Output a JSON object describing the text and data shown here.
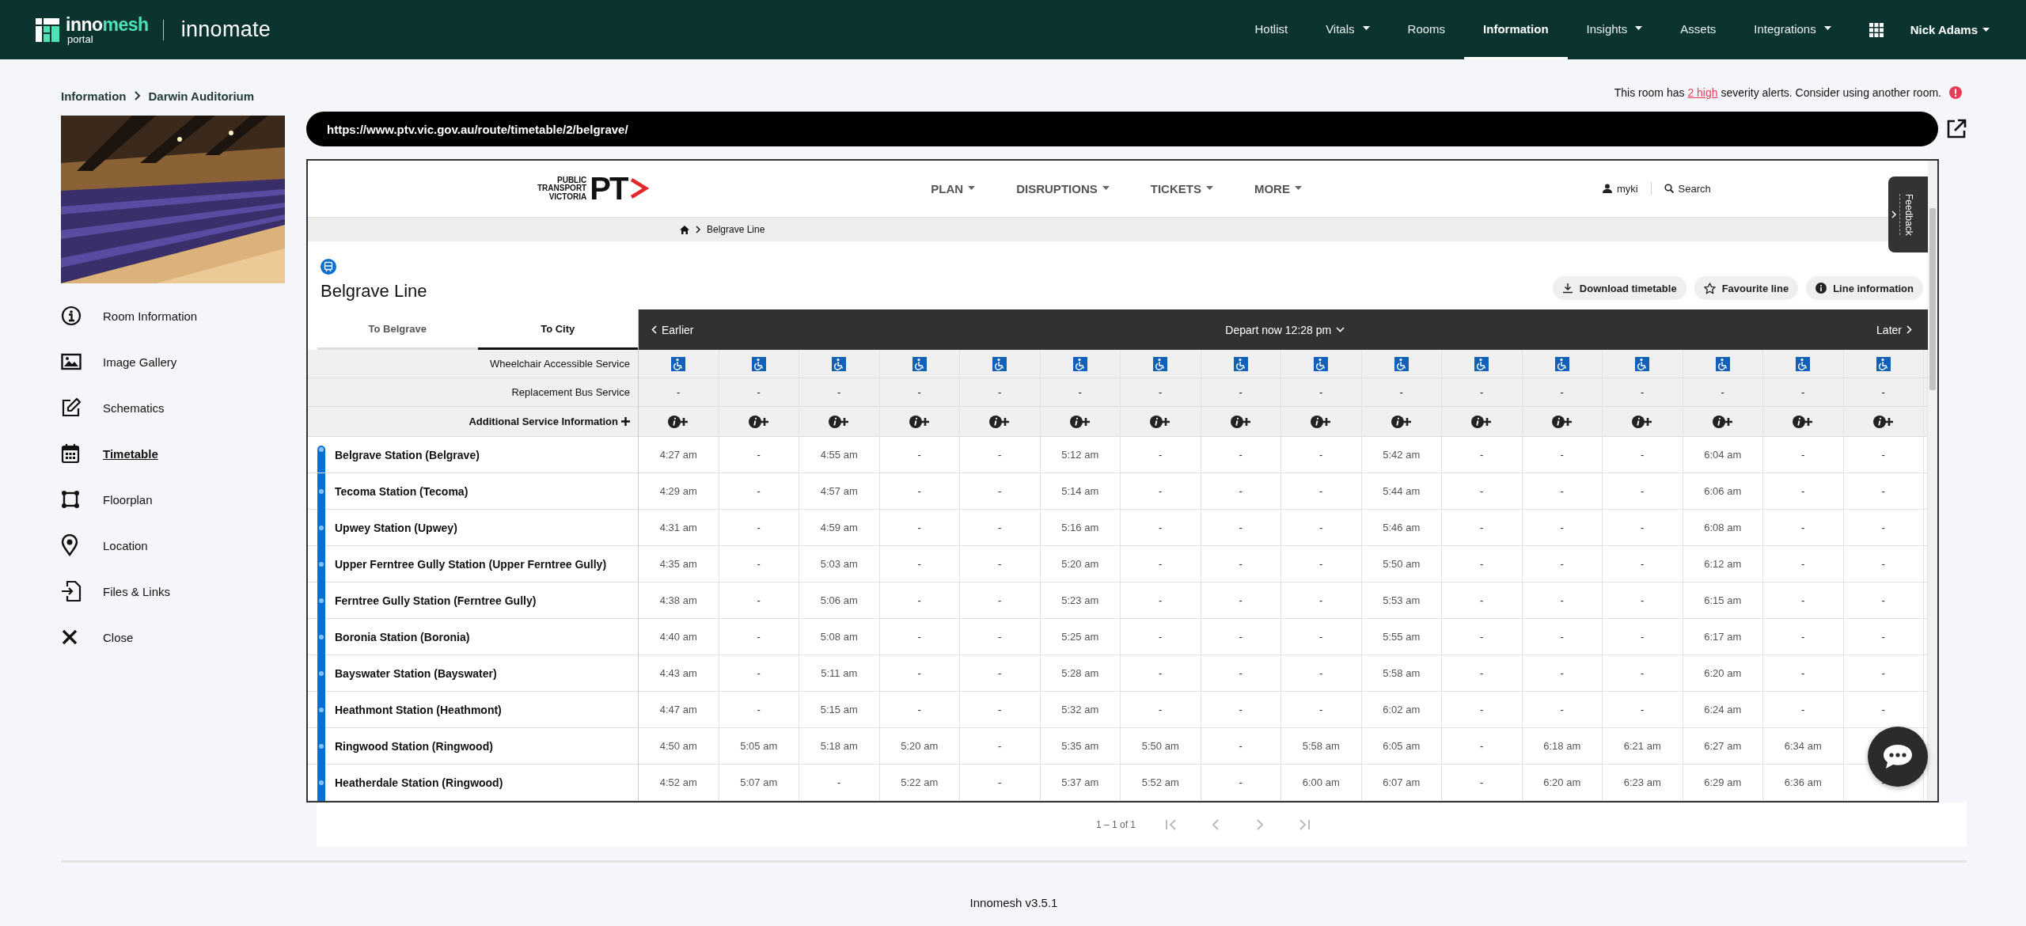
{
  "top_bar": {
    "logo_parts": [
      "inno",
      "mesh"
    ],
    "logo_subtext": "portal",
    "product": "innomate",
    "nav": [
      {
        "label": "Hotlist",
        "dropdown": false,
        "selected": false
      },
      {
        "label": "Vitals",
        "dropdown": true,
        "selected": false
      },
      {
        "label": "Rooms",
        "dropdown": false,
        "selected": false
      },
      {
        "label": "Information",
        "dropdown": false,
        "selected": true
      },
      {
        "label": "Insights",
        "dropdown": true,
        "selected": false
      },
      {
        "label": "Assets",
        "dropdown": false,
        "selected": false
      },
      {
        "label": "Integrations",
        "dropdown": true,
        "selected": false
      }
    ],
    "user": "Nick Adams"
  },
  "breadcrumb": [
    "Information",
    "Darwin Auditorium"
  ],
  "sidebar": {
    "items": [
      {
        "label": "Room Information",
        "kind": "info",
        "selected": false
      },
      {
        "label": "Image Gallery",
        "kind": "gallery",
        "selected": false
      },
      {
        "label": "Schematics",
        "kind": "edit",
        "selected": false
      },
      {
        "label": "Timetable",
        "kind": "calendar",
        "selected": true
      },
      {
        "label": "Floorplan",
        "kind": "floorplan",
        "selected": false
      },
      {
        "label": "Location",
        "kind": "location",
        "selected": false
      },
      {
        "label": "Files & Links",
        "kind": "files",
        "selected": false
      },
      {
        "label": "Close",
        "kind": "close",
        "selected": false
      }
    ]
  },
  "alert": {
    "before": "This room has",
    "link": "2 high",
    "after": "severity alerts. Consider using another room."
  },
  "url_bar": {
    "value": "https://www.ptv.vic.gov.au/route/timetable/2/belgrave/"
  },
  "ptv": {
    "logo_lines": [
      "PUBLIC",
      "TRANSPORT",
      "VICTORIA"
    ],
    "logo_mark": "PT",
    "nav": [
      "PLAN",
      "DISRUPTIONS",
      "TICKETS",
      "MORE"
    ],
    "myki": "myki",
    "search": "Search",
    "feedback": "Feedback",
    "breadcrumb": "Belgrave Line",
    "line_title": "Belgrave Line",
    "actions": [
      {
        "label": "Download timetable",
        "kind": "download"
      },
      {
        "label": "Favourite line",
        "kind": "star"
      },
      {
        "label": "Line information",
        "kind": "info"
      }
    ],
    "direction_tabs": [
      {
        "label": "To Belgrave",
        "selected": false
      },
      {
        "label": "To City",
        "selected": true
      }
    ],
    "earlier": "Earlier",
    "depart": "Depart now 12:28 pm",
    "later": "Later",
    "row_labels": {
      "wheelchair": "Wheelchair Accessible Service",
      "replacement": "Replacement Bus Service",
      "additional": "Additional Service Information"
    },
    "services": [
      {
        "wheelchair_accessible": true,
        "replacement_bus": "-"
      },
      {
        "wheelchair_accessible": true,
        "replacement_bus": "-"
      },
      {
        "wheelchair_accessible": true,
        "replacement_bus": "-"
      },
      {
        "wheelchair_accessible": true,
        "replacement_bus": "-"
      },
      {
        "wheelchair_accessible": true,
        "replacement_bus": "-"
      },
      {
        "wheelchair_accessible": true,
        "replacement_bus": "-"
      },
      {
        "wheelchair_accessible": true,
        "replacement_bus": "-"
      },
      {
        "wheelchair_accessible": true,
        "replacement_bus": "-"
      },
      {
        "wheelchair_accessible": true,
        "replacement_bus": "-"
      },
      {
        "wheelchair_accessible": true,
        "replacement_bus": "-"
      },
      {
        "wheelchair_accessible": true,
        "replacement_bus": "-"
      },
      {
        "wheelchair_accessible": true,
        "replacement_bus": "-"
      },
      {
        "wheelchair_accessible": true,
        "replacement_bus": "-"
      },
      {
        "wheelchair_accessible": true,
        "replacement_bus": "-"
      },
      {
        "wheelchair_accessible": true,
        "replacement_bus": "-"
      },
      {
        "wheelchair_accessible": true,
        "replacement_bus": "-"
      }
    ],
    "stations": [
      {
        "name": "Belgrave Station (Belgrave)",
        "times": [
          "4:27 am",
          "-",
          "4:55 am",
          "-",
          "-",
          "5:12 am",
          "-",
          "-",
          "-",
          "5:42 am",
          "-",
          "-",
          "-",
          "6:04 am",
          "-",
          "-"
        ]
      },
      {
        "name": "Tecoma Station (Tecoma)",
        "times": [
          "4:29 am",
          "-",
          "4:57 am",
          "-",
          "-",
          "5:14 am",
          "-",
          "-",
          "-",
          "5:44 am",
          "-",
          "-",
          "-",
          "6:06 am",
          "-",
          "-"
        ]
      },
      {
        "name": "Upwey Station (Upwey)",
        "times": [
          "4:31 am",
          "-",
          "4:59 am",
          "-",
          "-",
          "5:16 am",
          "-",
          "-",
          "-",
          "5:46 am",
          "-",
          "-",
          "-",
          "6:08 am",
          "-",
          "-"
        ]
      },
      {
        "name": "Upper Ferntree Gully Station (Upper Ferntree Gully)",
        "times": [
          "4:35 am",
          "-",
          "5:03 am",
          "-",
          "-",
          "5:20 am",
          "-",
          "-",
          "-",
          "5:50 am",
          "-",
          "-",
          "-",
          "6:12 am",
          "-",
          "-"
        ]
      },
      {
        "name": "Ferntree Gully Station (Ferntree Gully)",
        "times": [
          "4:38 am",
          "-",
          "5:06 am",
          "-",
          "-",
          "5:23 am",
          "-",
          "-",
          "-",
          "5:53 am",
          "-",
          "-",
          "-",
          "6:15 am",
          "-",
          "-"
        ]
      },
      {
        "name": "Boronia Station (Boronia)",
        "times": [
          "4:40 am",
          "-",
          "5:08 am",
          "-",
          "-",
          "5:25 am",
          "-",
          "-",
          "-",
          "5:55 am",
          "-",
          "-",
          "-",
          "6:17 am",
          "-",
          "-"
        ]
      },
      {
        "name": "Bayswater Station (Bayswater)",
        "times": [
          "4:43 am",
          "-",
          "5:11 am",
          "-",
          "-",
          "5:28 am",
          "-",
          "-",
          "-",
          "5:58 am",
          "-",
          "-",
          "-",
          "6:20 am",
          "-",
          "-"
        ]
      },
      {
        "name": "Heathmont Station (Heathmont)",
        "times": [
          "4:47 am",
          "-",
          "5:15 am",
          "-",
          "-",
          "5:32 am",
          "-",
          "-",
          "-",
          "6:02 am",
          "-",
          "-",
          "-",
          "6:24 am",
          "-",
          "-"
        ]
      },
      {
        "name": "Ringwood Station (Ringwood)",
        "times": [
          "4:50 am",
          "5:05 am",
          "5:18 am",
          "5:20 am",
          "-",
          "5:35 am",
          "5:50 am",
          "-",
          "5:58 am",
          "6:05 am",
          "-",
          "6:18 am",
          "6:21 am",
          "6:27 am",
          "6:34 am"
        ]
      },
      {
        "name": "Heatherdale Station (Ringwood)",
        "times": [
          "4:52 am",
          "5:07 am",
          "-",
          "5:22 am",
          "-",
          "5:37 am",
          "5:52 am",
          "-",
          "6:00 am",
          "6:07 am",
          "-",
          "6:20 am",
          "6:23 am",
          "6:29 am",
          "6:36 am",
          "-"
        ]
      }
    ]
  },
  "pagination": {
    "range": "1 – 1 of 1",
    "buttons": [
      {
        "kind": "first",
        "disabled": true
      },
      {
        "kind": "prev",
        "disabled": true
      },
      {
        "kind": "next",
        "disabled": true
      },
      {
        "kind": "last",
        "disabled": true
      }
    ]
  },
  "footer": {
    "version": "Innomesh v3.5.1"
  }
}
